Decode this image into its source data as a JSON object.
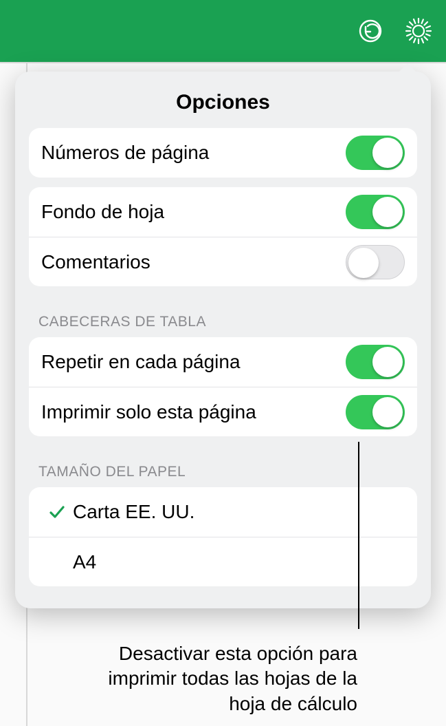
{
  "popover": {
    "title": "Opciones",
    "groups": [
      {
        "rows": [
          {
            "label": "Números de página",
            "on": true,
            "name": "toggle-page-numbers"
          }
        ]
      },
      {
        "rows": [
          {
            "label": "Fondo de hoja",
            "on": true,
            "name": "toggle-sheet-background"
          },
          {
            "label": "Comentarios",
            "on": false,
            "name": "toggle-comments"
          }
        ]
      },
      {
        "header": "CABECERAS DE TABLA",
        "rows": [
          {
            "label": "Repetir en cada página",
            "on": true,
            "name": "toggle-repeat-headers"
          },
          {
            "label": "Imprimir solo esta página",
            "on": true,
            "name": "toggle-print-this-sheet-only"
          }
        ]
      },
      {
        "header": "TAMAÑO DEL PAPEL",
        "type": "select",
        "rows": [
          {
            "label": "Carta EE. UU.",
            "selected": true,
            "name": "paper-size-us-letter"
          },
          {
            "label": "A4",
            "selected": false,
            "name": "paper-size-a4"
          }
        ]
      }
    ]
  },
  "callout": "Desactivar esta opción para imprimir todas las hojas de la hoja de cálculo"
}
